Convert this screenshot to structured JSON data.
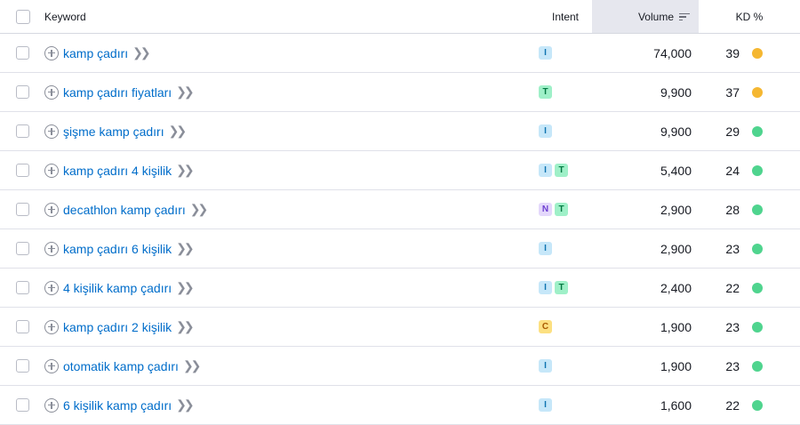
{
  "header": {
    "keyword": "Keyword",
    "intent": "Intent",
    "volume": "Volume",
    "kd": "KD %"
  },
  "colors": {
    "kd_orange": "#f5b731",
    "kd_green": "#4fd48e",
    "link": "#006dca"
  },
  "rows": [
    {
      "keyword": "kamp çadırı",
      "intents": [
        "I"
      ],
      "volume": "74,000",
      "kd": "39",
      "kd_color": "#f5b731"
    },
    {
      "keyword": "kamp çadırı fiyatları",
      "intents": [
        "T"
      ],
      "volume": "9,900",
      "kd": "37",
      "kd_color": "#f5b731"
    },
    {
      "keyword": "şişme kamp çadırı",
      "intents": [
        "I"
      ],
      "volume": "9,900",
      "kd": "29",
      "kd_color": "#4fd48e"
    },
    {
      "keyword": "kamp çadırı 4 kişilik",
      "intents": [
        "I",
        "T"
      ],
      "volume": "5,400",
      "kd": "24",
      "kd_color": "#4fd48e"
    },
    {
      "keyword": "decathlon kamp çadırı",
      "intents": [
        "N",
        "T"
      ],
      "volume": "2,900",
      "kd": "28",
      "kd_color": "#4fd48e"
    },
    {
      "keyword": "kamp çadırı 6 kişilik",
      "intents": [
        "I"
      ],
      "volume": "2,900",
      "kd": "23",
      "kd_color": "#4fd48e"
    },
    {
      "keyword": "4 kişilik kamp çadırı",
      "intents": [
        "I",
        "T"
      ],
      "volume": "2,400",
      "kd": "22",
      "kd_color": "#4fd48e"
    },
    {
      "keyword": "kamp çadırı 2 kişilik",
      "intents": [
        "C"
      ],
      "volume": "1,900",
      "kd": "23",
      "kd_color": "#4fd48e"
    },
    {
      "keyword": "otomatik kamp çadırı",
      "intents": [
        "I"
      ],
      "volume": "1,900",
      "kd": "23",
      "kd_color": "#4fd48e"
    },
    {
      "keyword": "6 kişilik kamp çadırı",
      "intents": [
        "I"
      ],
      "volume": "1,600",
      "kd": "22",
      "kd_color": "#4fd48e"
    }
  ]
}
